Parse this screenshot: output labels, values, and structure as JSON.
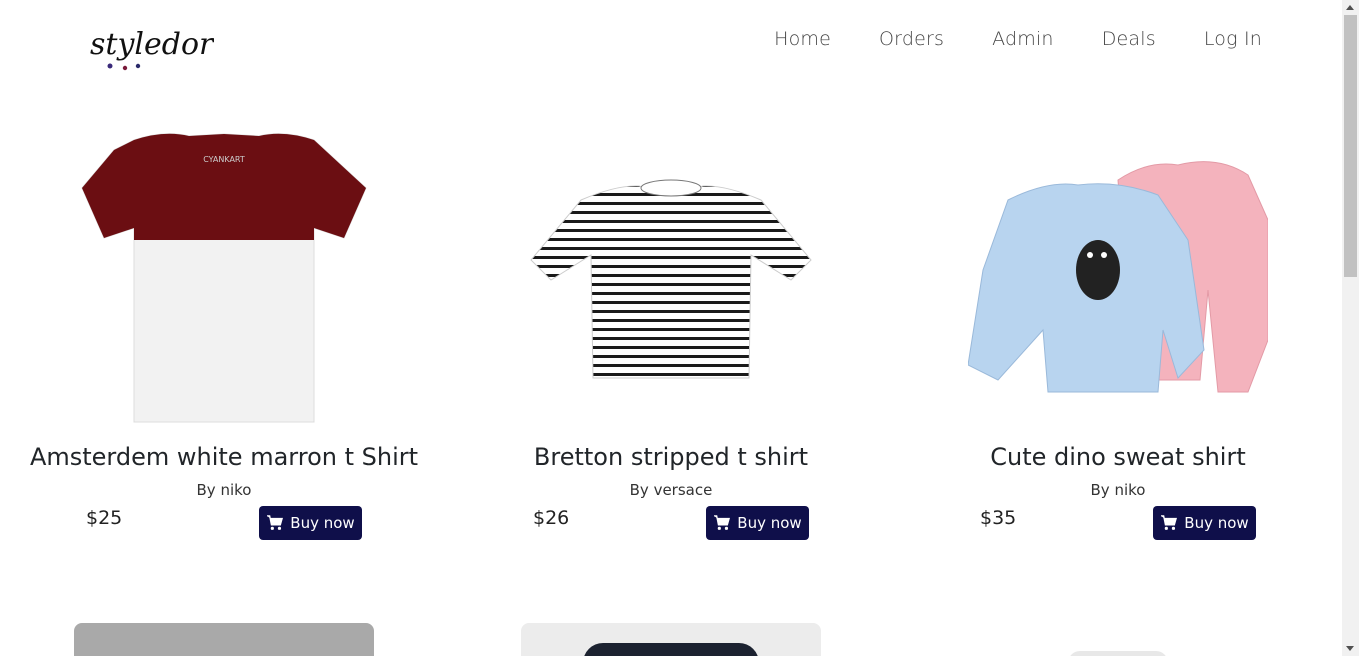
{
  "brand": {
    "name": "styledora"
  },
  "nav": {
    "items": [
      "Home",
      "Orders",
      "Admin",
      "Deals",
      "Log In"
    ]
  },
  "products": [
    {
      "title": "Amsterdem white marron t Shirt",
      "by": "By niko",
      "price": "$25",
      "button": "Buy now",
      "image_text": "CYANKART"
    },
    {
      "title": "Bretton stripped t shirt",
      "by": "By versace",
      "price": "$26",
      "button": "Buy now"
    },
    {
      "title": "Cute dino sweat shirt",
      "by": "By niko",
      "price": "$35",
      "button": "Buy now"
    }
  ],
  "colors": {
    "button_bg": "#0f0f4a",
    "button_text": "#ffffff",
    "shirt_maroon": "#6b0e12",
    "sweat_blue": "#b8d4ef",
    "sweat_pink": "#f4b3bd"
  }
}
